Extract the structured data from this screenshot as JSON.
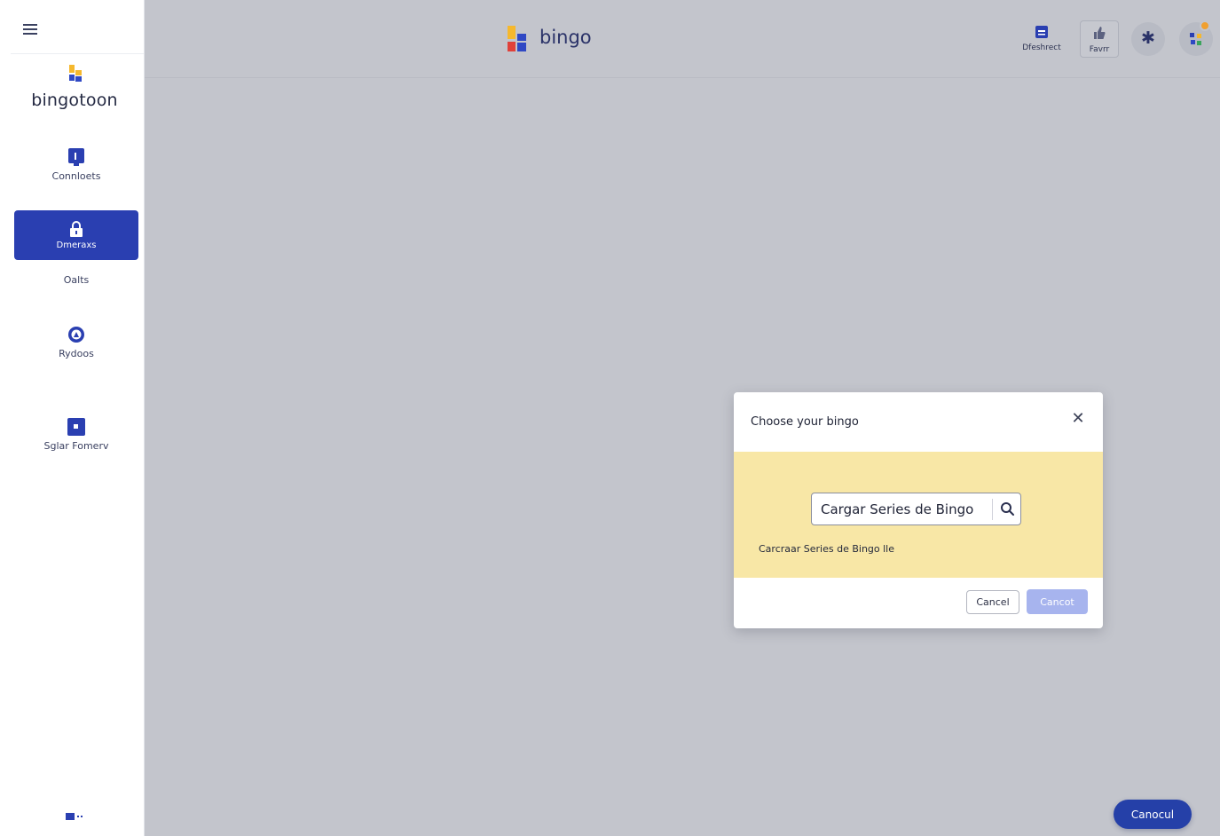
{
  "sidebar": {
    "brand_name": "bingotoon",
    "items": [
      {
        "label": "Connloets",
        "icon": "tablet-icon"
      },
      {
        "label": "Dmeraxs",
        "icon": "lock-icon",
        "active": true
      },
      {
        "label": "Rydoos",
        "icon": "location-pin-icon"
      },
      {
        "label": "Sglar Fomerv",
        "icon": "square-icon"
      }
    ],
    "sub_label": "Oalts"
  },
  "topbar": {
    "app_title": "bingo",
    "dashboard_label": "Dfeshrect",
    "faves_label": "Favrr"
  },
  "modal": {
    "title": "Choose your bingo",
    "search_value": "Cargar Series de Bingo",
    "file_hint": "Carcraar Series de Bingo lle",
    "cancel_label": "Cancel",
    "confirm_label": "Cancot"
  },
  "floating_button": {
    "label": "Canocul"
  },
  "colors": {
    "sidebar_active": "#2a3fb1",
    "main_overlay": "#c3c5cc",
    "modal_body": "#f8e7a6",
    "confirm_disabled": "#a7b4ee",
    "floating_button": "#2540a8",
    "logo_yellow": "#f5b82e",
    "logo_blue": "#2f48c4",
    "logo_red": "#e0413a"
  }
}
